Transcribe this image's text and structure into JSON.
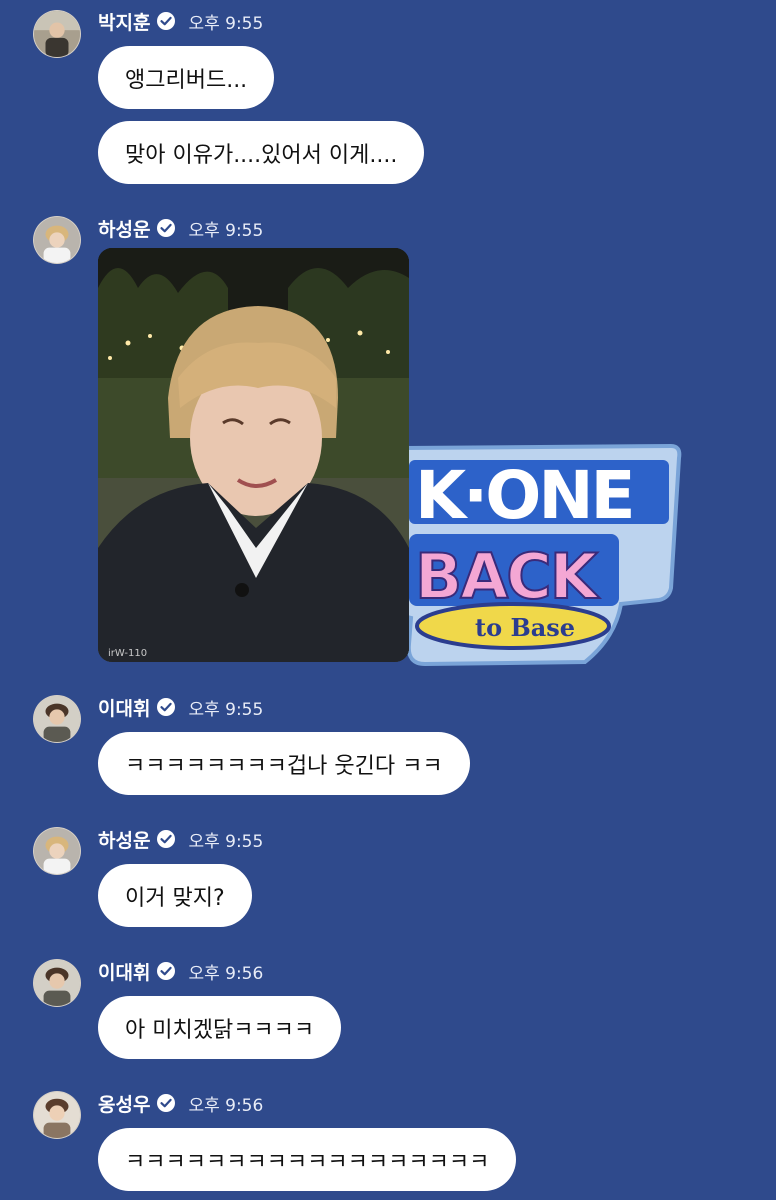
{
  "messages": [
    {
      "sender": "박지훈",
      "time": "오후 9:55",
      "bubbles": [
        "앵그리버드...",
        "맞아 이유가....있어서 이게...."
      ]
    },
    {
      "sender": "하성운",
      "time": "오후 9:55",
      "photo": {
        "caption_text": "irW-110"
      },
      "sticker": {
        "line1": "K·ONE",
        "line2": "BACK",
        "line3": "to Base"
      }
    },
    {
      "sender": "이대휘",
      "time": "오후 9:55",
      "bubbles": [
        "ㅋㅋㅋㅋㅋㅋㅋㅋ겁나 웃긴다 ㅋㅋ"
      ]
    },
    {
      "sender": "하성운",
      "time": "오후 9:55",
      "bubbles": [
        "이거 맞지?"
      ]
    },
    {
      "sender": "이대휘",
      "time": "오후 9:56",
      "bubbles": [
        "아 미치겠닭ㅋㅋㅋㅋ"
      ]
    },
    {
      "sender": "옹성우",
      "time": "오후 9:56",
      "bubbles": [
        "ㅋㅋㅋㅋㅋㅋㅋㅋㅋㅋㅋㅋㅋㅋㅋㅋㅋㅋ"
      ]
    }
  ],
  "colors": {
    "background": "#2f4a8c",
    "bubble": "#ffffff",
    "verified": "#ffffff"
  }
}
